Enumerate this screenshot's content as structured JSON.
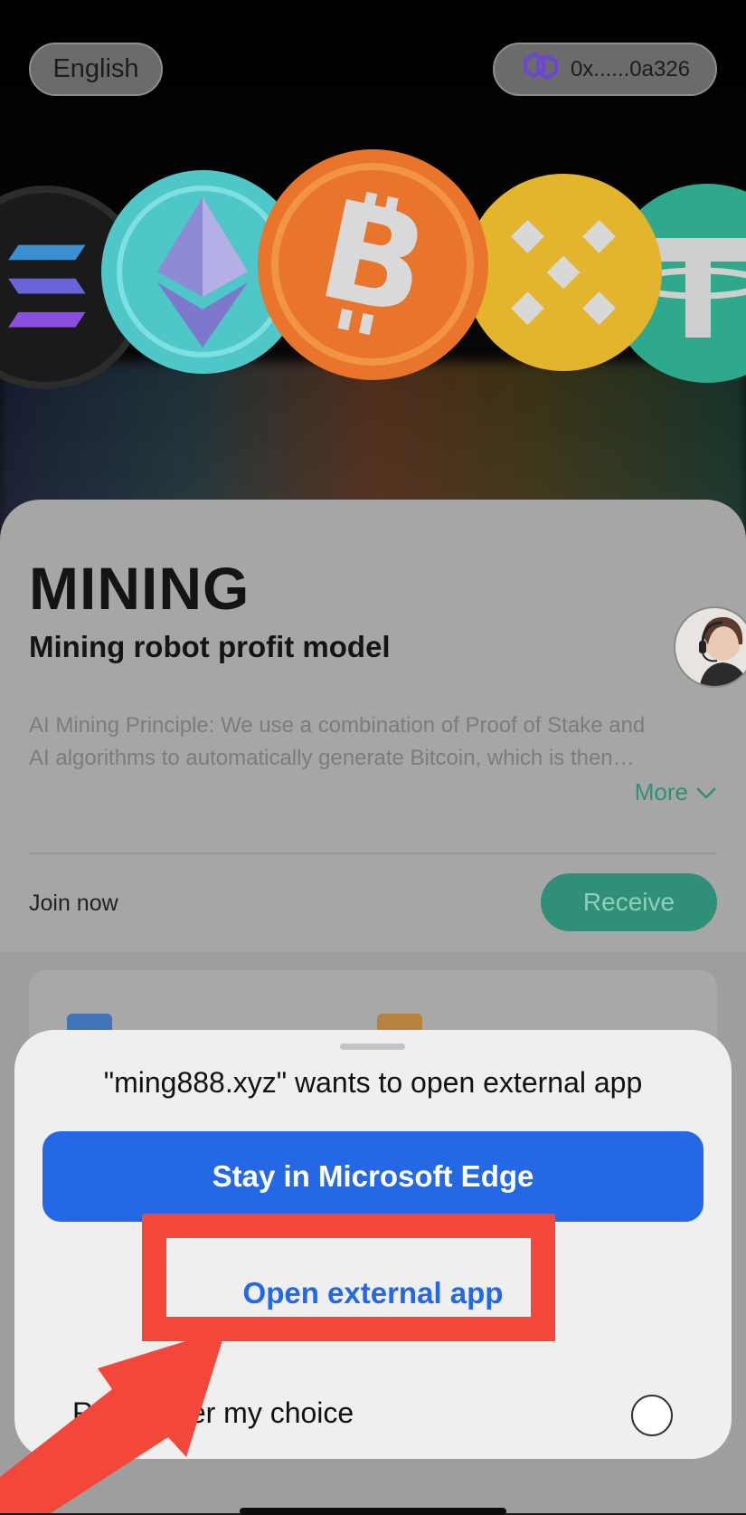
{
  "header": {
    "language_label": "English",
    "wallet_address": "0x......0a326",
    "wallet_icon": "polygon-icon"
  },
  "hero": {
    "coins": [
      "solana-coin",
      "ethereum-coin",
      "bitcoin-coin",
      "bnb-coin",
      "tether-coin"
    ]
  },
  "card": {
    "title": "MINING",
    "subtitle": "Mining robot profit model",
    "description_line1": "AI Mining Principle: We use a combination of Proof of Stake and",
    "description_line2": "AI algorithms to automatically generate Bitcoin, which is then…",
    "more_label": "More",
    "join_label": "Join now",
    "receive_label": "Receive"
  },
  "dialog": {
    "title": "\"ming888.xyz\" wants to open external app",
    "stay_label": "Stay in Microsoft Edge",
    "open_label": "Open external app",
    "remember_label": "Remember my choice",
    "remember_checked": false
  },
  "colors": {
    "accent_blue": "#2468e5",
    "accent_green": "#2f8f77",
    "annotation_red": "#f3473c"
  }
}
